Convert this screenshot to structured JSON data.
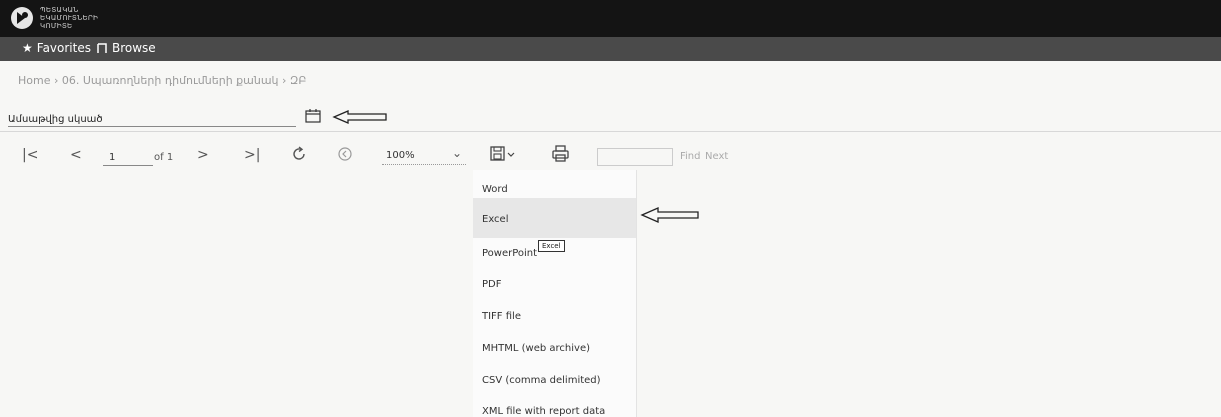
{
  "header": {
    "logo_text": "ՊԵՏԱԿԱՆ ԵԿԱՄՈՒՏՆԵՐԻ ԿՈՄԻՏԵ",
    "favorites_label": "Favorites",
    "browse_label": "Browse"
  },
  "breadcrumb": {
    "text": "Home  ›  06. Սպառողների դիմումների քանակ  ›  ԶԲ"
  },
  "parameter": {
    "label": "Ամսաթվից սկսած"
  },
  "toolbar": {
    "page_value": "1",
    "page_of": "of 1",
    "zoom": "100%",
    "find_label": "Find",
    "next_label": "Next"
  },
  "export_menu": {
    "items": [
      "Word",
      "Excel",
      "PowerPoint",
      "PDF",
      "TIFF file",
      "MHTML (web archive)",
      "CSV (comma delimited)",
      "XML file with report data"
    ],
    "tooltip": "Excel"
  }
}
